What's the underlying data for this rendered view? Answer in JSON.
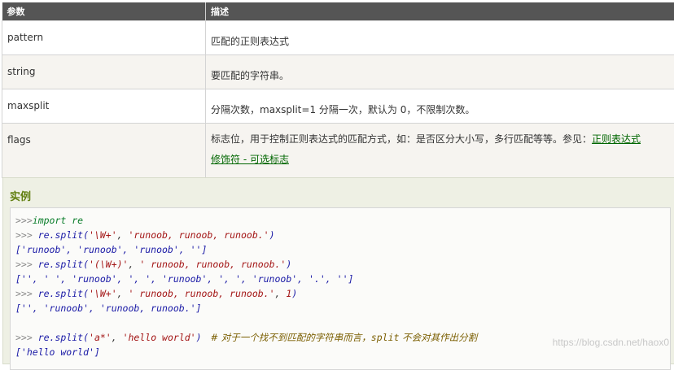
{
  "table": {
    "headers": [
      "参数",
      "描述"
    ],
    "rows": [
      {
        "param": "pattern",
        "desc": "匹配的正则表达式"
      },
      {
        "param": "string",
        "desc": "要匹配的字符串。"
      },
      {
        "param": "maxsplit",
        "desc": "分隔次数，maxsplit=1 分隔一次，默认为 0，不限制次数。"
      },
      {
        "param": "flags",
        "desc": "标志位，用于控制正则表达式的匹配方式，如：是否区分大小写，多行匹配等等。参见：",
        "link1": "正则表达式",
        "link2": "修饰符 - 可选标志"
      }
    ]
  },
  "example": {
    "title": "实例",
    "code": {
      "l1_prompt": ">>>",
      "l1_kw": "import",
      "l1_rest": " re",
      "l2_prompt": ">>> ",
      "l2_fn": "re.split(",
      "l2_s1": "'\\W+'",
      "l2_sep": ", ",
      "l2_s2": "'runoob, runoob, runoob.'",
      "l2_end": ")",
      "l3_out": "['runoob', 'runoob', 'runoob', '']",
      "l4_prompt": ">>> ",
      "l4_fn": "re.split(",
      "l4_s1": "'(\\W+)'",
      "l4_sep": ", ",
      "l4_s2": "' runoob, runoob, runoob.'",
      "l4_end": ")",
      "l5_out": "['', ' ', 'runoob', ', ', 'runoob', ', ', 'runoob', '.', '']",
      "l6_prompt": ">>> ",
      "l6_fn": "re.split(",
      "l6_s1": "'\\W+'",
      "l6_sep": ", ",
      "l6_s2": "' runoob, runoob, runoob.'",
      "l6_sep2": ", ",
      "l6_num": "1",
      "l6_end": ")",
      "l7_out": "['', 'runoob', 'runoob, runoob.']",
      "l9_prompt": ">>> ",
      "l9_fn": "re.split(",
      "l9_s1": "'a*'",
      "l9_sep": ", ",
      "l9_s2": "'hello world'",
      "l9_end": ")",
      "l9_comment_a": "   # 对于一个找不到匹配的字符串而言，",
      "l9_comment_b": "split",
      "l9_comment_c": " 不会对其作出分割",
      "l10_out": "['hello world']"
    }
  },
  "watermark": "https://blog.csdn.net/haox0"
}
